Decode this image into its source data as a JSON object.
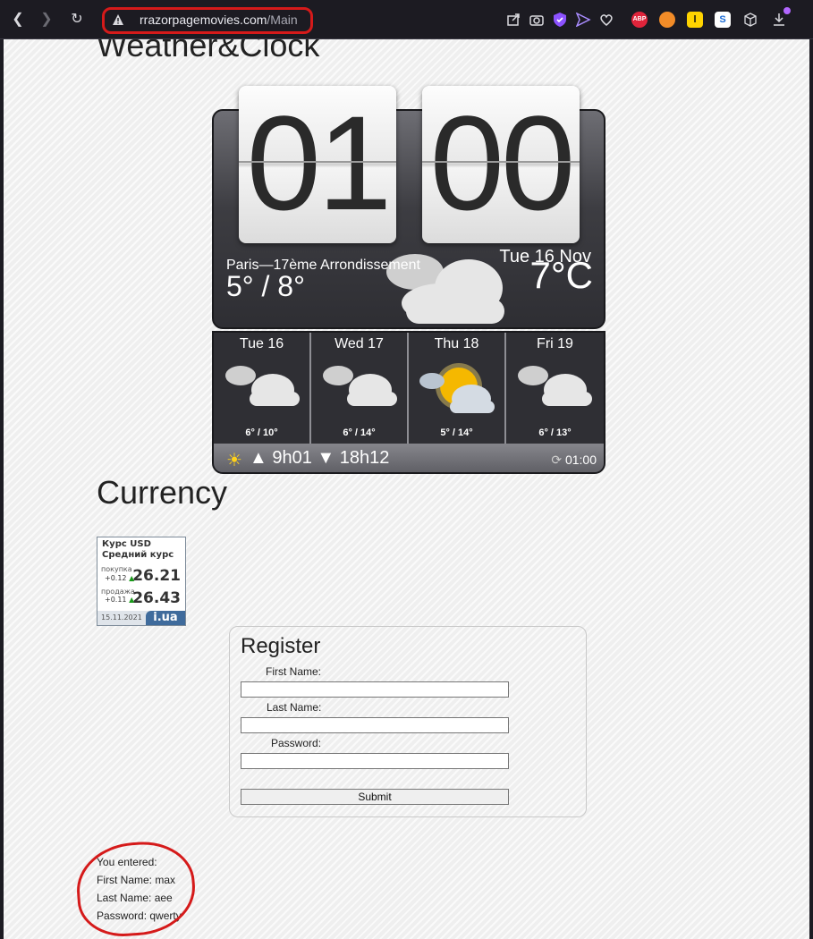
{
  "browser": {
    "url_domain": "rrazorpagemovies.com",
    "url_path": "/Main",
    "icons": [
      "back-icon",
      "forward-icon",
      "reload-icon",
      "warning-icon",
      "share-icon",
      "camera-icon",
      "shield-icon",
      "send-icon",
      "heart-icon",
      "abp-icon",
      "extension-icon",
      "l-icon",
      "s-icon",
      "cube-icon",
      "download-icon"
    ],
    "ext_labels": {
      "abp": "ABP",
      "l": "l",
      "s": "S"
    }
  },
  "weather": {
    "heading": "Weather&Clock",
    "hour": "01",
    "minute": "00",
    "city": "Paris—17ème Arrondissement",
    "minmax": "5° / 8°",
    "date": "Tue 16 Nov",
    "temp": "7°C",
    "forecast": [
      {
        "day": "Tue 16",
        "range": "6° / 10°",
        "icon": "cloud-icon"
      },
      {
        "day": "Wed 17",
        "range": "6° / 14°",
        "icon": "cloud-icon"
      },
      {
        "day": "Thu 18",
        "range": "5° / 14°",
        "icon": "sun-cloud-icon"
      },
      {
        "day": "Fri 19",
        "range": "6° / 13°",
        "icon": "cloud-icon"
      }
    ],
    "sun_times": "▲ 9h01   ▼ 18h12",
    "updated": "01:00"
  },
  "currency": {
    "heading": "Currency",
    "title": "Курс USD",
    "subtitle": "Средний курс",
    "buy_label": "покупка",
    "buy_change": "+0.12",
    "buy_value": "26.21",
    "sell_label": "продажа",
    "sell_change": "+0.11",
    "sell_value": "26.43",
    "date": "15.11.2021",
    "logo": "i.ua"
  },
  "register": {
    "title": "Register",
    "first_label": "First Name:",
    "last_label": "Last Name:",
    "password_label": "Password:",
    "first_value": "",
    "last_value": "",
    "password_value": "",
    "submit": "Submit"
  },
  "result": {
    "line0": "You entered:",
    "line1": "First Name: max",
    "line2": "Last Name: aee",
    "line3": "Password: qwerty"
  }
}
